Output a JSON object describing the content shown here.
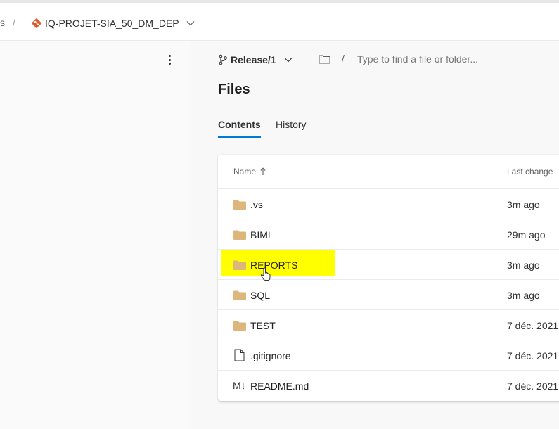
{
  "breadcrumb": {
    "previous": "s",
    "separator": "/",
    "repo_name": "IQ-PROJET-SIA_50_DM_DEP"
  },
  "toolbar": {
    "branch": "Release/1",
    "path_separator": "/",
    "search_placeholder": "Type to find a file or folder..."
  },
  "page": {
    "title": "Files"
  },
  "tabs": [
    {
      "label": "Contents",
      "selected": true
    },
    {
      "label": "History",
      "selected": false
    }
  ],
  "table": {
    "columns": {
      "name": "Name",
      "last_change": "Last change"
    },
    "sort_icon": "arrow-up-icon",
    "rows": [
      {
        "icon": "folder-icon",
        "name": ".vs",
        "last_change": "3m ago"
      },
      {
        "icon": "folder-icon",
        "name": "BIML",
        "last_change": "29m ago"
      },
      {
        "icon": "folder-icon",
        "name": "REPORTS",
        "last_change": "3m ago",
        "highlighted": true
      },
      {
        "icon": "folder-icon",
        "name": "SQL",
        "last_change": "3m ago"
      },
      {
        "icon": "folder-icon",
        "name": "TEST",
        "last_change": "7 déc. 2021"
      },
      {
        "icon": "file-icon",
        "name": ".gitignore",
        "last_change": "7 déc. 2021"
      },
      {
        "icon": "markdown-icon",
        "icon_text": "M↓",
        "name": "README.md",
        "last_change": "7 déc. 2021"
      }
    ]
  },
  "colors": {
    "accent": "#0078d4",
    "highlight": "#ffff00",
    "folder": "#dcb67a",
    "repo_icon": "#e05a2b"
  }
}
